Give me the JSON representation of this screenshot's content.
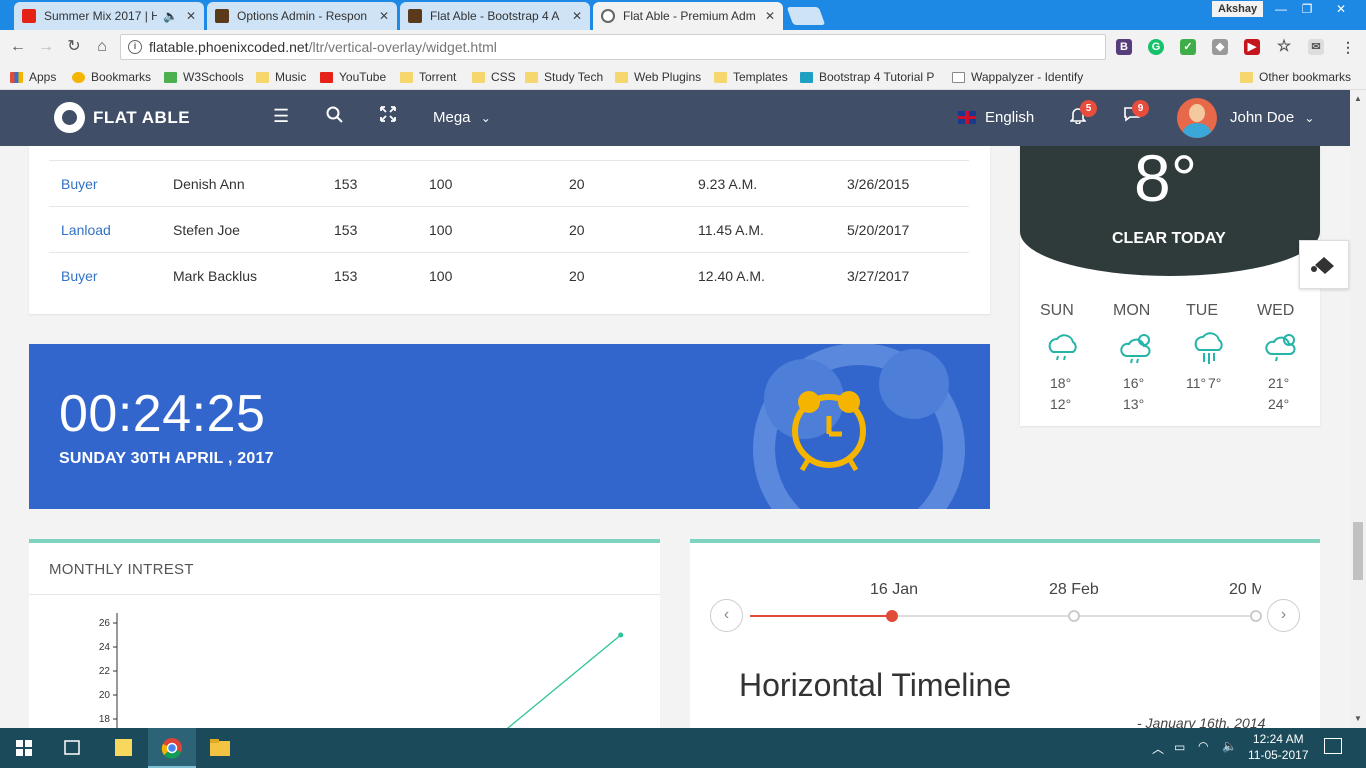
{
  "browser": {
    "tabs": [
      {
        "title": "Summer Mix 2017 | H",
        "fav_color": "#e62117",
        "active": false
      },
      {
        "title": "Options Admin - Respon",
        "fav_color": "#5a3a1a",
        "active": false
      },
      {
        "title": "Flat Able - Bootstrap 4 A",
        "fav_color": "#5a3a1a",
        "active": false
      },
      {
        "title": "Flat Able - Premium Adm",
        "fav_color": "#555555",
        "active": true
      }
    ],
    "window_user": "Akshay",
    "url_host": "flatable.phoenixcoded.net",
    "url_path": "/ltr/vertical-overlay/widget.html",
    "bookmarks": [
      {
        "label": "Apps",
        "icon_color": "#e04b3a"
      },
      {
        "label": "Bookmarks",
        "icon_color": "#f5b400"
      },
      {
        "label": "W3Schools",
        "icon_color": "#4caf50"
      },
      {
        "label": "Music",
        "icon_color": "#f5d76e"
      },
      {
        "label": "YouTube",
        "icon_color": "#e62117"
      },
      {
        "label": "Torrent",
        "icon_color": "#f5d76e"
      },
      {
        "label": "CSS",
        "icon_color": "#f5d76e"
      },
      {
        "label": "Study Tech",
        "icon_color": "#f5d76e"
      },
      {
        "label": "Web Plugins",
        "icon_color": "#f5d76e"
      },
      {
        "label": "Templates",
        "icon_color": "#f5d76e"
      },
      {
        "label": "Bootstrap 4 Tutorial P",
        "icon_color": "#1ea0c3"
      },
      {
        "label": "Wappalyzer - Identify",
        "icon_color": "#ffffff"
      },
      {
        "label": "Other bookmarks",
        "icon_color": "#f5d76e"
      }
    ]
  },
  "header": {
    "brand": "FLAT ABLE",
    "mega_label": "Mega",
    "language": "English",
    "notifications_count": "5",
    "messages_count": "9",
    "user_name": "John Doe"
  },
  "table": {
    "rows": [
      {
        "type": "Buyer",
        "name": "Denish Ann",
        "c1": "153",
        "c2": "100",
        "c3": "20",
        "time": "9.23 A.M.",
        "date": "3/26/2015"
      },
      {
        "type": "Lanload",
        "name": "Stefen Joe",
        "c1": "153",
        "c2": "100",
        "c3": "20",
        "time": "11.45 A.M.",
        "date": "5/20/2017"
      },
      {
        "type": "Buyer",
        "name": "Mark Backlus",
        "c1": "153",
        "c2": "100",
        "c3": "20",
        "time": "12.40 A.M.",
        "date": "3/27/2017"
      }
    ]
  },
  "clock": {
    "time": "00:24:25",
    "date": "SUNDAY 30TH APRIL , 2017"
  },
  "weather": {
    "temp": "8°",
    "condition": "CLEAR TODAY",
    "days": [
      {
        "day": "SUN",
        "high": "18°",
        "low": "12°",
        "icon": "rain-cloud-icon"
      },
      {
        "day": "MON",
        "high": "16°",
        "low": "13°",
        "icon": "sun-rain-cloud-icon"
      },
      {
        "day": "TUE",
        "high": "11°",
        "low": "7°",
        "icon": "heavy-rain-icon"
      },
      {
        "day": "WED",
        "high": "21°",
        "low": "24°",
        "icon": "sun-rain-cloud-icon"
      }
    ]
  },
  "monthly": {
    "title": "MONTHLY INTREST"
  },
  "chart_data": {
    "type": "line",
    "title": "MONTHLY INTREST",
    "y_ticks": [
      18,
      20,
      22,
      24,
      26
    ],
    "ylim": [
      17,
      27
    ],
    "points": [
      {
        "x": 0.74,
        "y": 16
      },
      {
        "x": 1.0,
        "y": 25
      }
    ],
    "color": "#2ec39a"
  },
  "timeline": {
    "dates": [
      "16 Jan",
      "28 Feb",
      "20 M"
    ],
    "title": "Horizontal Timeline",
    "date_line": "- January 16th, 2014"
  },
  "taskbar": {
    "time": "12:24 AM",
    "date": "11-05-2017"
  }
}
